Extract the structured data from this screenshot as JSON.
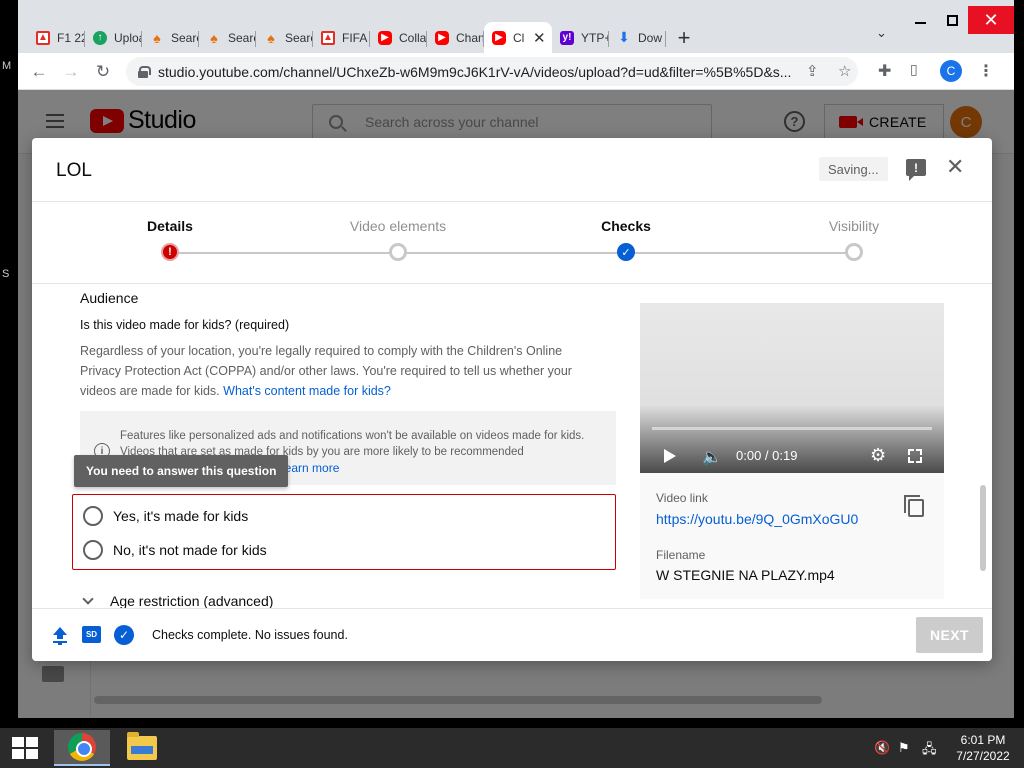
{
  "desktop": {
    "side_text_1": "M",
    "side_text_2": "S"
  },
  "browser": {
    "tabs": [
      {
        "label": "F1 22",
        "icon": "f1-icon"
      },
      {
        "label": "Uploa",
        "icon": "upload-icon"
      },
      {
        "label": "Searc",
        "icon": "search-tab-icon"
      },
      {
        "label": "Searc",
        "icon": "search-tab-icon"
      },
      {
        "label": "Searc",
        "icon": "search-tab-icon"
      },
      {
        "label": "FIFA",
        "icon": "f1-icon"
      },
      {
        "label": "Colla",
        "icon": "youtube-icon"
      },
      {
        "label": "Chan",
        "icon": "youtube-icon"
      },
      {
        "label": "Cl",
        "icon": "youtube-icon",
        "active": true
      },
      {
        "label": "YTP+",
        "icon": "yahoo-icon"
      },
      {
        "label": "Dow",
        "icon": "download-icon"
      }
    ],
    "new_tab_symbol": "+",
    "url": "studio.youtube.com/channel/UChxeZb-w6M9m9cJ6K1rV-vA/videos/upload?d=ud&filter=%5B%5D&s...",
    "profile_letter": "C"
  },
  "studio": {
    "logo_text": "Studio",
    "search_placeholder": "Search across your channel",
    "create_label": "CREATE",
    "avatar_letter": "C"
  },
  "dialog": {
    "title": "LOL",
    "saving_label": "Saving...",
    "steps": [
      {
        "label": "Details",
        "state": "error"
      },
      {
        "label": "Video elements",
        "state": "pending"
      },
      {
        "label": "Checks",
        "state": "done"
      },
      {
        "label": "Visibility",
        "state": "pending"
      }
    ],
    "audience": {
      "section_title": "Audience",
      "question": "Is this video made for kids? (required)",
      "description": "Regardless of your location, you're legally required to comply with the Children's Online Privacy Protection Act (COPPA) and/or other laws. You're required to tell us whether your videos are made for kids.",
      "description_link": "What's content made for kids?",
      "info_text": "Features like personalized ads and notifications won't be available on videos made for kids. Videos that are set as made for kids by you are more likely to be recommended",
      "info_link": "Learn more",
      "tooltip": "You need to answer this question",
      "option_yes": "Yes, it's made for kids",
      "option_no": "No, it's not made for kids",
      "age_restriction": "Age restriction (advanced)"
    },
    "video": {
      "time": "0:00 / 0:19",
      "link_label": "Video link",
      "link": "https://youtu.be/9Q_0GmXoGU0",
      "filename_label": "Filename",
      "filename": "W STEGNIE NA PLAZY.mp4"
    },
    "footer": {
      "status": "Checks complete. No issues found.",
      "sd_badge": "SD",
      "next_label": "NEXT"
    }
  },
  "taskbar": {
    "time": "6:01 PM",
    "date": "7/27/2022"
  },
  "colors": {
    "accent_blue": "#065fd4",
    "error_red": "#cc0000",
    "youtube_red": "#ff0000"
  }
}
